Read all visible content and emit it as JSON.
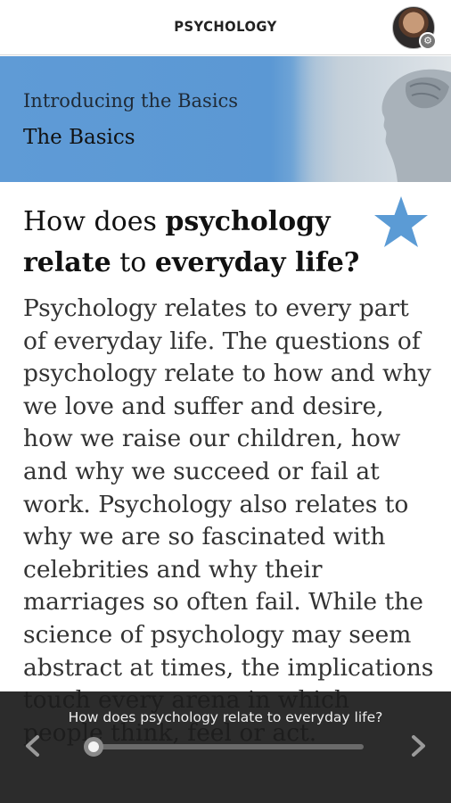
{
  "header": {
    "app_title": "PSYCHOLOGY"
  },
  "banner": {
    "subtitle": "Introducing the Basics",
    "title": "The Basics"
  },
  "article": {
    "question_parts": [
      "How does ",
      "psychology",
      " relate",
      " to ",
      "everyday life?"
    ],
    "body": "Psychology relates to every part of everyday life. The questions of psychology relate to how and why we love and suffer and desire, how we raise our children, how and why we succeed or fail at work. Psychology also relates to why we are so fascinated with celebrities and why their marriages so often fail. While the science of psychology may seem abstract at times, the implications touch every arena in which people think, feel or act."
  },
  "icons": {
    "favorite": "star-icon",
    "prev": "chevron-left-icon",
    "next": "chevron-right-icon",
    "avatar": "user-avatar"
  },
  "footer": {
    "caption": "How does psychology relate to everyday life?",
    "progress": 0.0
  },
  "colors": {
    "banner_blue": "#5b98d4",
    "star_blue": "#5b9bd5",
    "footer_bg": "#1c1c1c"
  }
}
